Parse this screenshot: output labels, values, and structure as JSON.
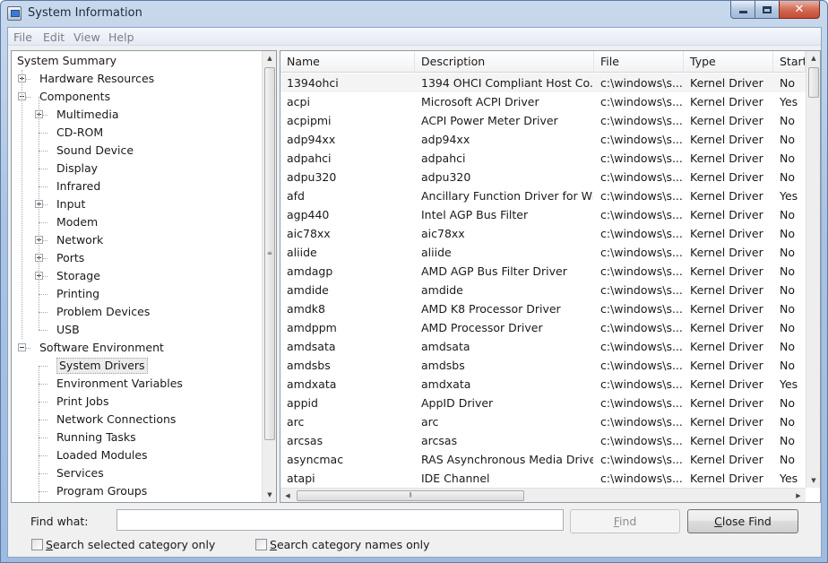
{
  "window": {
    "title": "System Information"
  },
  "menu": [
    "File",
    "Edit",
    "View",
    "Help"
  ],
  "tree": [
    {
      "label": "System Summary",
      "level": 0,
      "expander": "none"
    },
    {
      "label": "Hardware Resources",
      "level": 1,
      "expander": "plus"
    },
    {
      "label": "Components",
      "level": 1,
      "expander": "minus"
    },
    {
      "label": "Multimedia",
      "level": 2,
      "expander": "plus"
    },
    {
      "label": "CD-ROM",
      "level": 2,
      "expander": "none"
    },
    {
      "label": "Sound Device",
      "level": 2,
      "expander": "none"
    },
    {
      "label": "Display",
      "level": 2,
      "expander": "none"
    },
    {
      "label": "Infrared",
      "level": 2,
      "expander": "none"
    },
    {
      "label": "Input",
      "level": 2,
      "expander": "plus"
    },
    {
      "label": "Modem",
      "level": 2,
      "expander": "none"
    },
    {
      "label": "Network",
      "level": 2,
      "expander": "plus"
    },
    {
      "label": "Ports",
      "level": 2,
      "expander": "plus"
    },
    {
      "label": "Storage",
      "level": 2,
      "expander": "plus"
    },
    {
      "label": "Printing",
      "level": 2,
      "expander": "none"
    },
    {
      "label": "Problem Devices",
      "level": 2,
      "expander": "none"
    },
    {
      "label": "USB",
      "level": 2,
      "expander": "none"
    },
    {
      "label": "Software Environment",
      "level": 1,
      "expander": "minus"
    },
    {
      "label": "System Drivers",
      "level": 2,
      "expander": "none",
      "selected": true
    },
    {
      "label": "Environment Variables",
      "level": 2,
      "expander": "none"
    },
    {
      "label": "Print Jobs",
      "level": 2,
      "expander": "none"
    },
    {
      "label": "Network Connections",
      "level": 2,
      "expander": "none"
    },
    {
      "label": "Running Tasks",
      "level": 2,
      "expander": "none"
    },
    {
      "label": "Loaded Modules",
      "level": 2,
      "expander": "none"
    },
    {
      "label": "Services",
      "level": 2,
      "expander": "none"
    },
    {
      "label": "Program Groups",
      "level": 2,
      "expander": "none"
    }
  ],
  "columns": [
    "Name",
    "Description",
    "File",
    "Type",
    "Start"
  ],
  "rows": [
    [
      "1394ohci",
      "1394 OHCI Compliant Host Co...",
      "c:\\windows\\s...",
      "Kernel Driver",
      "No"
    ],
    [
      "acpi",
      "Microsoft ACPI Driver",
      "c:\\windows\\s...",
      "Kernel Driver",
      "Yes"
    ],
    [
      "acpipmi",
      "ACPI Power Meter Driver",
      "c:\\windows\\s...",
      "Kernel Driver",
      "No"
    ],
    [
      "adp94xx",
      "adp94xx",
      "c:\\windows\\s...",
      "Kernel Driver",
      "No"
    ],
    [
      "adpahci",
      "adpahci",
      "c:\\windows\\s...",
      "Kernel Driver",
      "No"
    ],
    [
      "adpu320",
      "adpu320",
      "c:\\windows\\s...",
      "Kernel Driver",
      "No"
    ],
    [
      "afd",
      "Ancillary Function Driver for Wi...",
      "c:\\windows\\s...",
      "Kernel Driver",
      "Yes"
    ],
    [
      "agp440",
      "Intel AGP Bus Filter",
      "c:\\windows\\s...",
      "Kernel Driver",
      "No"
    ],
    [
      "aic78xx",
      "aic78xx",
      "c:\\windows\\s...",
      "Kernel Driver",
      "No"
    ],
    [
      "aliide",
      "aliide",
      "c:\\windows\\s...",
      "Kernel Driver",
      "No"
    ],
    [
      "amdagp",
      "AMD AGP Bus Filter Driver",
      "c:\\windows\\s...",
      "Kernel Driver",
      "No"
    ],
    [
      "amdide",
      "amdide",
      "c:\\windows\\s...",
      "Kernel Driver",
      "No"
    ],
    [
      "amdk8",
      "AMD K8 Processor Driver",
      "c:\\windows\\s...",
      "Kernel Driver",
      "No"
    ],
    [
      "amdppm",
      "AMD Processor Driver",
      "c:\\windows\\s...",
      "Kernel Driver",
      "No"
    ],
    [
      "amdsata",
      "amdsata",
      "c:\\windows\\s...",
      "Kernel Driver",
      "No"
    ],
    [
      "amdsbs",
      "amdsbs",
      "c:\\windows\\s...",
      "Kernel Driver",
      "No"
    ],
    [
      "amdxata",
      "amdxata",
      "c:\\windows\\s...",
      "Kernel Driver",
      "Yes"
    ],
    [
      "appid",
      "AppID Driver",
      "c:\\windows\\s...",
      "Kernel Driver",
      "No"
    ],
    [
      "arc",
      "arc",
      "c:\\windows\\s...",
      "Kernel Driver",
      "No"
    ],
    [
      "arcsas",
      "arcsas",
      "c:\\windows\\s...",
      "Kernel Driver",
      "No"
    ],
    [
      "asyncmac",
      "RAS Asynchronous Media Driver",
      "c:\\windows\\s...",
      "Kernel Driver",
      "No"
    ],
    [
      "atapi",
      "IDE Channel",
      "c:\\windows\\s...",
      "Kernel Driver",
      "Yes"
    ]
  ],
  "find": {
    "label": "Find what:",
    "value": "",
    "find_button": "Find",
    "close_button": "Close Find",
    "search_selected_label": "Search selected category only",
    "search_names_label": "Search category names only"
  },
  "icons": {
    "app": "system-info-icon",
    "minimize": "minimize-icon",
    "maximize": "maximize-icon",
    "close": "close-icon",
    "scroll_up": "chevron-up-icon",
    "scroll_down": "chevron-down-icon",
    "scroll_left": "chevron-left-icon",
    "scroll_right": "chevron-right-icon"
  },
  "colors": {
    "close_button": "#c44a33",
    "titlebar": "#aac3e2"
  }
}
